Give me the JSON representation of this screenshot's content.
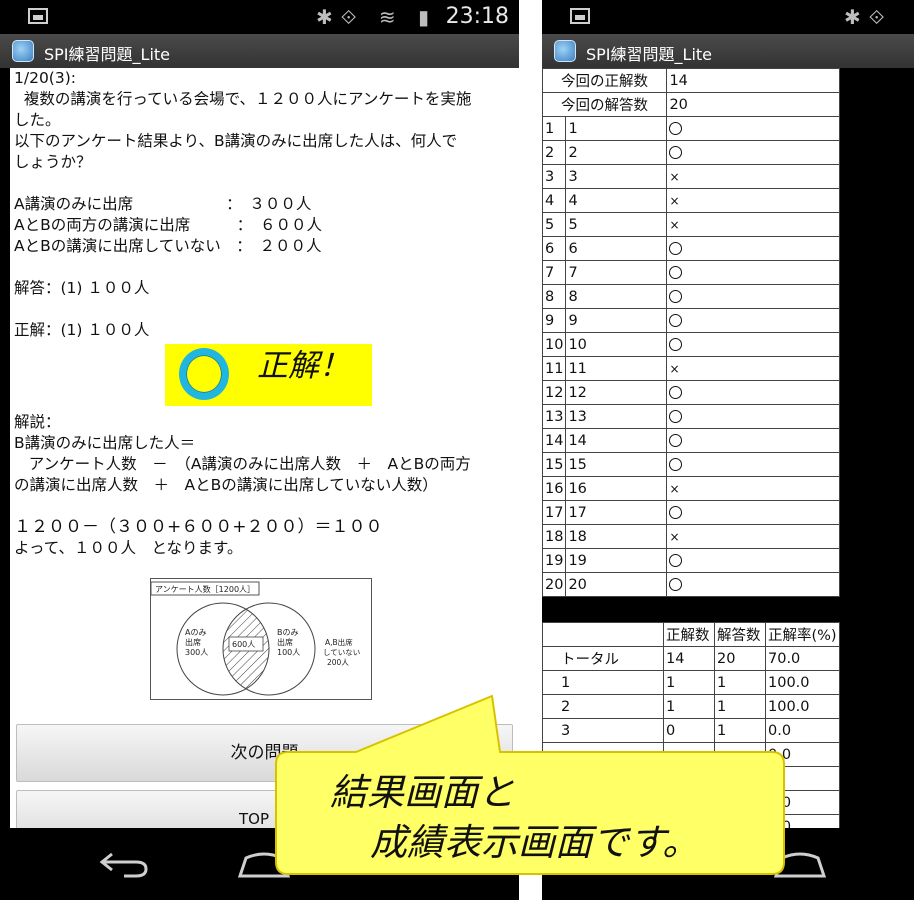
{
  "left": {
    "status_time": "23:18",
    "app_title": "SPI練習問題_Lite",
    "question_number": "1/20(3):",
    "question_lines": [
      "  複数の講演を行っている会場で、１２００人にアンケートを実施",
      "した。",
      "以下のアンケート結果より、B講演のみに出席した人は、何人で",
      "しょうか？"
    ],
    "survey_lines": [
      "A講演のみに出席　　　　　　：　３００人",
      "AとBの両方の講演に出席　　　：　６００人",
      "AとBの講演に出席していない　：　２００人"
    ],
    "answer": "解答：(1) １００人",
    "correct": "正解：(1) １００人",
    "badge_text": "正解！",
    "explanation_title": "解説：",
    "explanation_lines": [
      "B講演のみに出席した人＝",
      "   アンケート人数　－　（A講演のみに出席人数　＋　AとBの両方",
      "の講演に出席人数　＋　AとBの講演に出席していない人数）"
    ],
    "formula_lines": [
      "１２００－（３００+６００+２００）＝１００",
      "よって、１００人　となります。"
    ],
    "diagram": {
      "header": "アンケート人数［1200人］",
      "a_only": [
        "Aのみ",
        "出席",
        "300人"
      ],
      "both": "600人",
      "b_only": [
        "Bのみ",
        "出席",
        "100人"
      ],
      "neither": [
        "A,B出席",
        "していない",
        "200人"
      ]
    },
    "next_button": "次の問題",
    "top_button": "TOP"
  },
  "right": {
    "app_title": "SPI練習問題_Lite",
    "summary": [
      {
        "label": "今回の正解数",
        "value": "14"
      },
      {
        "label": "今回の解答数",
        "value": "20"
      }
    ],
    "results": [
      {
        "n": "1",
        "q": "1",
        "mark": "o"
      },
      {
        "n": "2",
        "q": "2",
        "mark": "o"
      },
      {
        "n": "3",
        "q": "3",
        "mark": "×"
      },
      {
        "n": "4",
        "q": "4",
        "mark": "×"
      },
      {
        "n": "5",
        "q": "5",
        "mark": "×"
      },
      {
        "n": "6",
        "q": "6",
        "mark": "o"
      },
      {
        "n": "7",
        "q": "7",
        "mark": "o"
      },
      {
        "n": "8",
        "q": "8",
        "mark": "o"
      },
      {
        "n": "9",
        "q": "9",
        "mark": "o"
      },
      {
        "n": "10",
        "q": "10",
        "mark": "o"
      },
      {
        "n": "11",
        "q": "11",
        "mark": "×"
      },
      {
        "n": "12",
        "q": "12",
        "mark": "o"
      },
      {
        "n": "13",
        "q": "13",
        "mark": "o"
      },
      {
        "n": "14",
        "q": "14",
        "mark": "o"
      },
      {
        "n": "15",
        "q": "15",
        "mark": "o"
      },
      {
        "n": "16",
        "q": "16",
        "mark": "×"
      },
      {
        "n": "17",
        "q": "17",
        "mark": "o"
      },
      {
        "n": "18",
        "q": "18",
        "mark": "×"
      },
      {
        "n": "19",
        "q": "19",
        "mark": "o"
      },
      {
        "n": "20",
        "q": "20",
        "mark": "o"
      }
    ],
    "stats_headers": [
      "",
      "正解数",
      "解答数",
      "正解率(%)"
    ],
    "stats_rows": [
      [
        "トータル",
        "14",
        "20",
        "70.0"
      ],
      [
        "1",
        "1",
        "1",
        "100.0"
      ],
      [
        "2",
        "1",
        "1",
        "100.0"
      ],
      [
        "3",
        "0",
        "1",
        "0.0"
      ],
      [
        "",
        "",
        "",
        "0.0"
      ],
      [
        "",
        "",
        "",
        ""
      ],
      [
        "",
        "",
        "",
        "0.0"
      ],
      [
        "",
        "",
        "",
        "0.0"
      ]
    ]
  },
  "callout": {
    "line1": "結果画面と",
    "line2": "成績表示画面です。",
    "fill": "#ffff66",
    "stroke": "#d8c200"
  }
}
